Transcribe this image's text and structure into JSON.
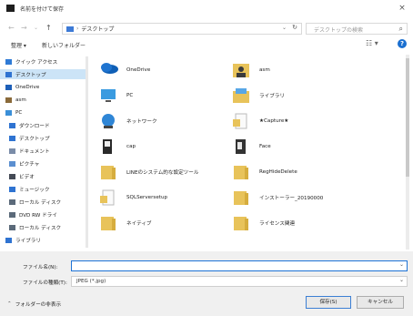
{
  "window": {
    "title": "名前を付けて保存",
    "close_glyph": "×"
  },
  "address_bar": {
    "back": "←",
    "forward": "→",
    "up": "↑",
    "path_separator": "›",
    "path": "デスクトップ",
    "dropdown": "⌄",
    "refresh": "↻"
  },
  "search": {
    "placeholder": "デスクトップの検索",
    "icon": "⌕"
  },
  "toolbar": {
    "organize": "整理 ▾",
    "new_folder": "新しいフォルダー",
    "view": "☷ ▾",
    "help": "?"
  },
  "nav_pane": {
    "items": [
      {
        "label": "クイック アクセス",
        "icon": "star-icon",
        "color": "#2f7bd6"
      },
      {
        "label": "デスクトップ",
        "icon": "desktop-icon",
        "color": "#2f73d1",
        "selected": true
      },
      {
        "label": "OneDrive",
        "icon": "onedrive-icon",
        "color": "#1e5fb8"
      },
      {
        "label": "asm",
        "icon": "user-icon",
        "color": "#8a6a3a"
      },
      {
        "label": "PC",
        "icon": "pc-icon",
        "color": "#3a8fd8"
      },
      {
        "label": "ダウンロード",
        "icon": "download-icon",
        "color": "#2f73d1"
      },
      {
        "label": "デスクトップ",
        "icon": "desktop-icon",
        "color": "#2f73d1"
      },
      {
        "label": "ドキュメント",
        "icon": "documents-icon",
        "color": "#7a8ca8"
      },
      {
        "label": "ピクチャ",
        "icon": "pictures-icon",
        "color": "#5b8fd0"
      },
      {
        "label": "ビデオ",
        "icon": "videos-icon",
        "color": "#444a55"
      },
      {
        "label": "ミュージック",
        "icon": "music-icon",
        "color": "#2f73d1"
      },
      {
        "label": "ローカル ディスク",
        "icon": "drive-icon",
        "color": "#5b6a7a"
      },
      {
        "label": "DVD RW ドライ",
        "icon": "dvd-icon",
        "color": "#5b6a7a"
      },
      {
        "label": "ローカル ディスク",
        "icon": "drive-icon",
        "color": "#5b6a7a"
      },
      {
        "label": "ライブラリ",
        "icon": "library-icon",
        "color": "#2f73d1"
      }
    ]
  },
  "files": [
    {
      "label": "OneDrive",
      "icon": "onedrive-icon"
    },
    {
      "label": "asm",
      "icon": "user-folder-icon"
    },
    {
      "label": "PC",
      "icon": "pc-icon"
    },
    {
      "label": "ライブラリ",
      "icon": "library-icon"
    },
    {
      "label": "ネットワーク",
      "icon": "network-icon"
    },
    {
      "label": "★Capture★",
      "icon": "document-icon"
    },
    {
      "label": "cap",
      "icon": "cap-icon"
    },
    {
      "label": "Face",
      "icon": "face-icon"
    },
    {
      "label": "LINEのシステム的な設定ツール",
      "icon": "folder-icon"
    },
    {
      "label": "RegHideDelete",
      "icon": "folder-icon"
    },
    {
      "label": "SQLServersetup",
      "icon": "document-icon"
    },
    {
      "label": "インストーラー_20190000",
      "icon": "folder-icon"
    },
    {
      "label": "ネイティブ",
      "icon": "folder-icon"
    },
    {
      "label": "ライセンス関連",
      "icon": "folder-icon"
    }
  ],
  "bottom": {
    "filename_label": "ファイル名(N):",
    "filename_value": "",
    "filetype_label": "ファイルの種類(T):",
    "filetype_value": "JPEG (*.jpg)",
    "dropdown": "⌄",
    "hide_folders": "フォルダーの非表示",
    "hide_folders_glyph": "⌃",
    "save": "保存(S)",
    "cancel": "キャンセル"
  },
  "colors": {
    "accent": "#1e73d6",
    "folder": "#e8c35a",
    "selection": "#cce4f7"
  }
}
